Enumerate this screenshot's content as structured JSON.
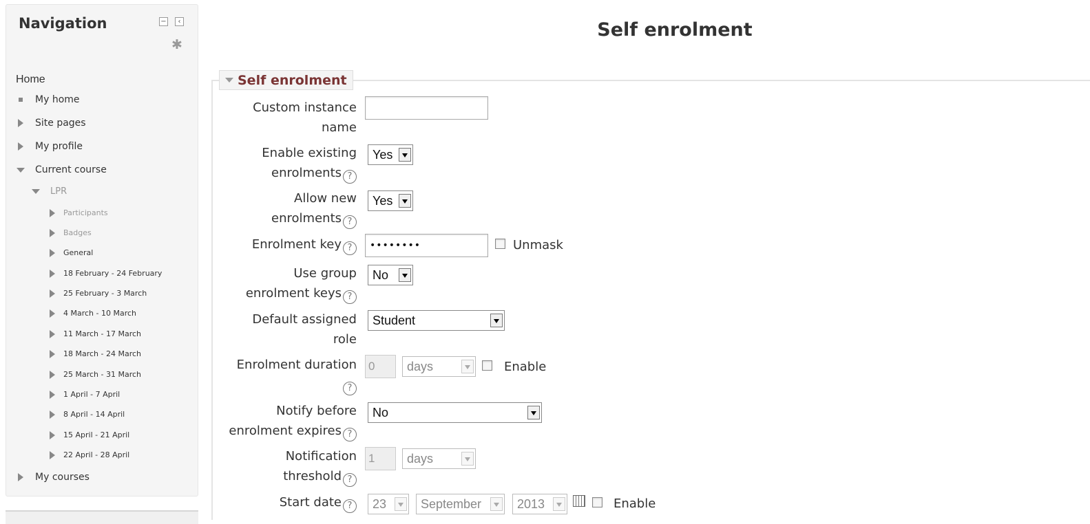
{
  "navigation": {
    "title": "Navigation",
    "home": "Home",
    "items": [
      {
        "label": "My home"
      },
      {
        "label": "Site pages"
      },
      {
        "label": "My profile"
      },
      {
        "label": "Current course"
      }
    ],
    "course": {
      "name": "LPR",
      "items": [
        {
          "label": "Participants"
        },
        {
          "label": "Badges"
        },
        {
          "label": "General"
        },
        {
          "label": "18 February - 24 February"
        },
        {
          "label": "25 February - 3 March"
        },
        {
          "label": "4 March - 10 March"
        },
        {
          "label": "11 March - 17 March"
        },
        {
          "label": "18 March - 24 March"
        },
        {
          "label": "25 March - 31 March"
        },
        {
          "label": "1 April - 7 April"
        },
        {
          "label": "8 April - 14 April"
        },
        {
          "label": "15 April - 21 April"
        },
        {
          "label": "22 April - 28 April"
        }
      ]
    },
    "my_courses": "My courses",
    "controls": {
      "collapse_icon": "minus-box-icon",
      "dock_icon": "dock-left-icon",
      "settings_icon": "gear-icon"
    }
  },
  "page": {
    "heading": "Self enrolment",
    "section_legend": "Self enrolment"
  },
  "form": {
    "custom_instance_name": {
      "label_line1": "Custom instance",
      "label_line2": "name",
      "value": ""
    },
    "enable_existing": {
      "label_line1": "Enable existing",
      "label_line2": "enrolments",
      "value": "Yes"
    },
    "allow_new": {
      "label_line1": "Allow new",
      "label_line2": "enrolments",
      "value": "Yes"
    },
    "enrolment_key": {
      "label": "Enrolment key",
      "value": "••••••••",
      "unmask_label": "Unmask"
    },
    "use_group_keys": {
      "label_line1": "Use group",
      "label_line2": "enrolment keys",
      "value": "No"
    },
    "default_role": {
      "label_line1": "Default assigned",
      "label_line2": "role",
      "value": "Student"
    },
    "enrolment_duration": {
      "label": "Enrolment duration",
      "number": "0",
      "unit": "days",
      "enable_label": "Enable"
    },
    "notify_before": {
      "label_line1": "Notify before",
      "label_line2": "enrolment expires",
      "value": "No"
    },
    "notification_threshold": {
      "label_line1": "Notification",
      "label_line2": "threshold",
      "number": "1",
      "unit": "days"
    },
    "start_date": {
      "label": "Start date",
      "day": "23",
      "month": "September",
      "year": "2013",
      "enable_label": "Enable"
    },
    "help_glyph": "?"
  },
  "colors": {
    "legend_text": "#7a3434",
    "nav_bg": "#f5f5f5"
  }
}
